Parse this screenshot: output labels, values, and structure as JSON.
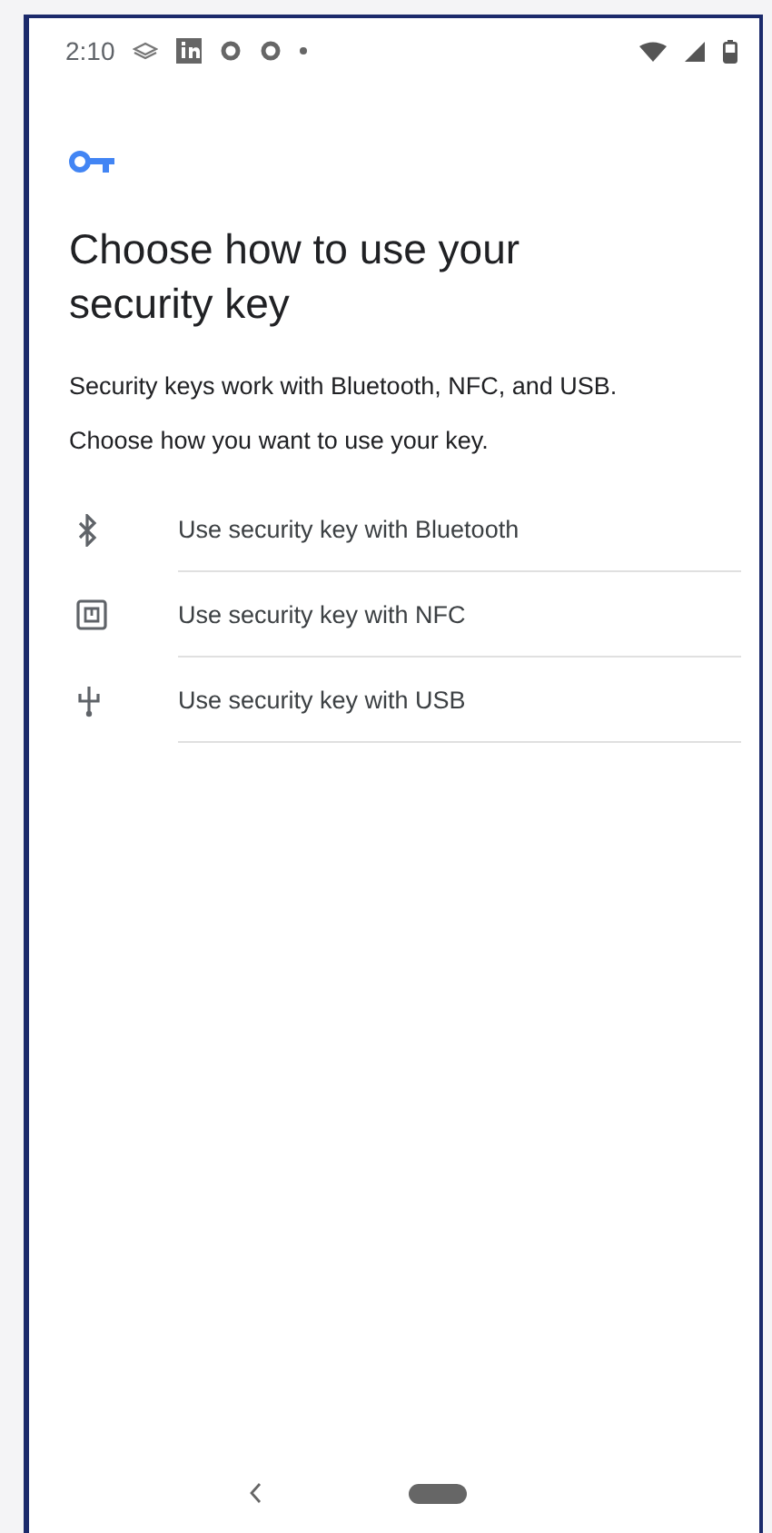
{
  "status_bar": {
    "time": "2:10"
  },
  "title": "Choose how to use your security key",
  "description": [
    "Security keys work with Bluetooth, NFC, and USB.",
    "Choose how you want to use your key."
  ],
  "options": [
    {
      "kind": "bluetooth",
      "label": "Use security key with Bluetooth"
    },
    {
      "kind": "nfc",
      "label": "Use security key with NFC"
    },
    {
      "kind": "usb",
      "label": "Use security key with USB"
    }
  ]
}
